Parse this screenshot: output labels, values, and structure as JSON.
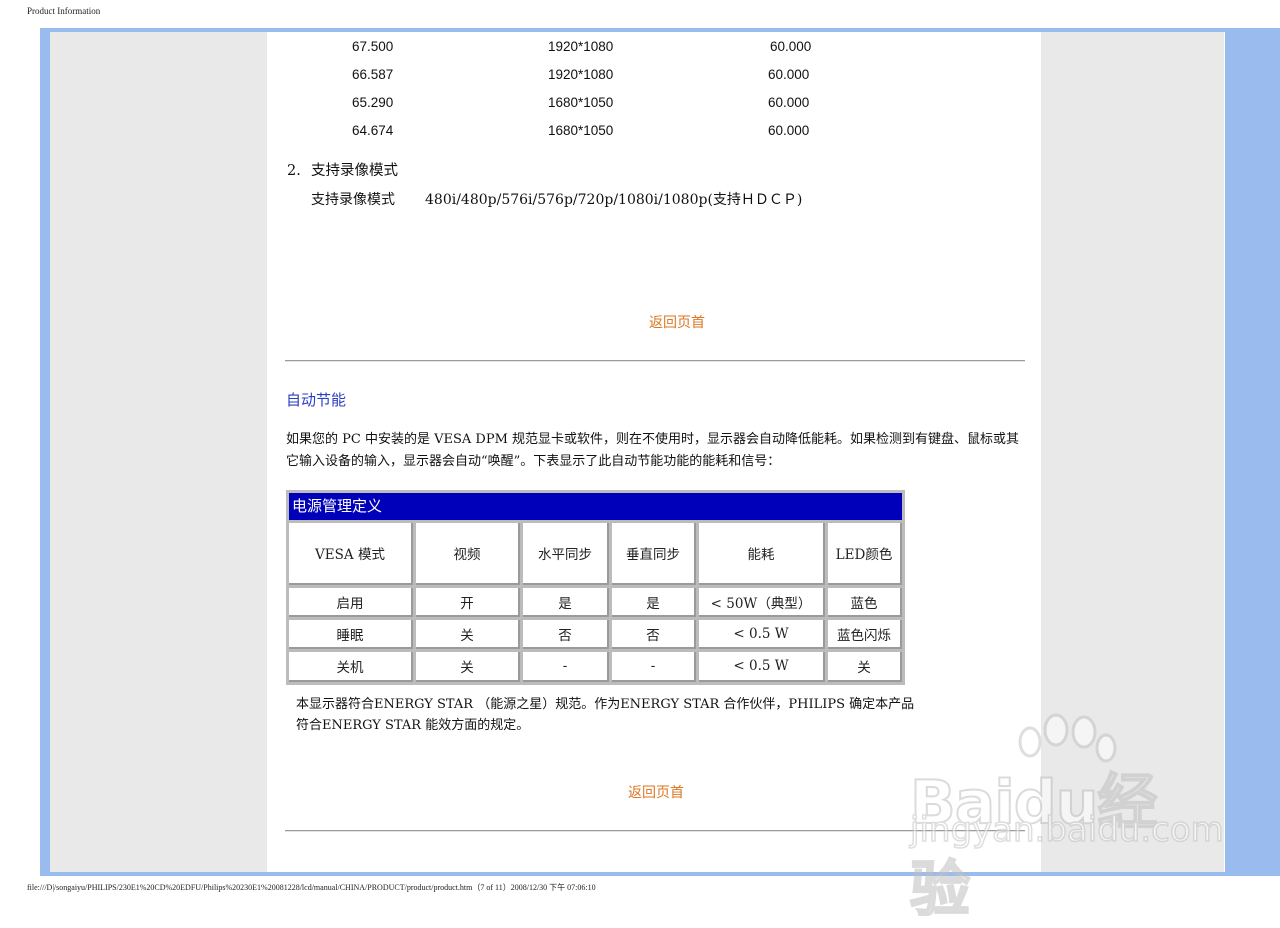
{
  "print_header": "Product Information",
  "print_footer": "file:///D|/songaiyu/PHILIPS/230E1%20CD%20EDFU/Philips%20230E1%20081228/lcd/manual/CHINA/PRODUCT/product/product.htm（7 of 11）2008/12/30 下午 07:06:10",
  "timing_rows": [
    {
      "hfreq": "67.500",
      "resolution": "1920*1080",
      "vfreq": "60.000"
    },
    {
      "hfreq": "66.587",
      "resolution": "1920*1080",
      "vfreq": "60.000"
    },
    {
      "hfreq": "65.290",
      "resolution": "1680*1050",
      "vfreq": "60.000"
    },
    {
      "hfreq": "64.674",
      "resolution": "1680*1050",
      "vfreq": "60.000"
    }
  ],
  "video_section": {
    "number": "2.",
    "title": "支持录像模式",
    "label": "支持录像模式",
    "value": "480i/480p/576i/576p/720p/1080i/1080p(支持ＨＤＣＰ)"
  },
  "back_to_top": "返回页首",
  "power_section": {
    "title": "自动节能",
    "paragraph": "如果您的 PC 中安装的是 VESA DPM 规范显卡或软件，则在不使用时，显示器会自动降低能耗。如果检测到有键盘、鼠标或其它输入设备的输入，显示器会自动“唤醒”。下表显示了此自动节能功能的能耗和信号：",
    "table_title": "电源管理定义",
    "headers": [
      "VESA 模式",
      "视频",
      "水平同步",
      "垂直同步",
      "能耗",
      "LED颜色"
    ],
    "rows": [
      [
        "启用",
        "开",
        "是",
        "是",
        "< 50W（典型）",
        "蓝色"
      ],
      [
        "睡眠",
        "关",
        "否",
        "否",
        "< 0.5 W",
        "蓝色闪烁"
      ],
      [
        "关机",
        "关",
        "-",
        "-",
        "< 0.5 W",
        "关"
      ]
    ],
    "note": "本显示器符合ENERGY STAR （能源之星）规范。作为ENERGY STAR 合作伙伴，PHILIPS 确定本产品符合ENERGY STAR 能效方面的规定。"
  },
  "watermark": {
    "logo": "Baidu经验",
    "url": "jingyan.baidu.com"
  }
}
